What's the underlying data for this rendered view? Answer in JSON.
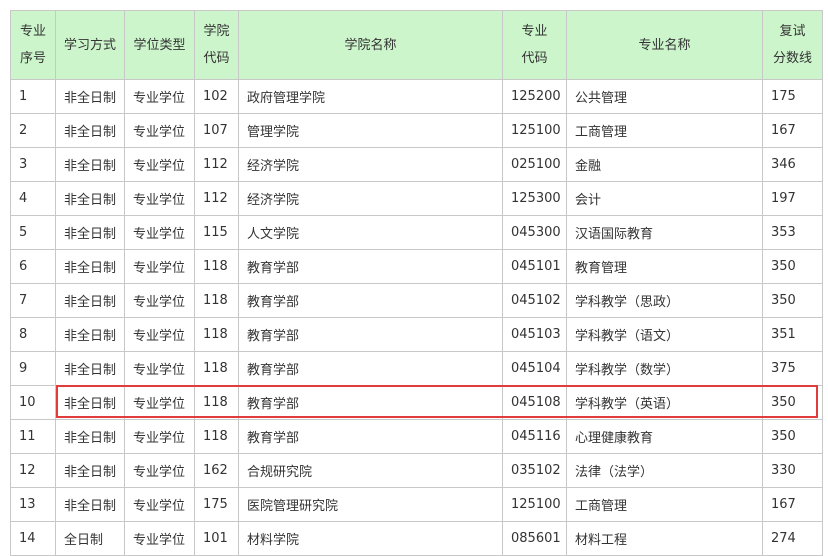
{
  "headers": {
    "seq": [
      "专业",
      "序号"
    ],
    "mode": "学习方式",
    "degree": "学位类型",
    "college_code": [
      "学院",
      "代码"
    ],
    "college_name": "学院名称",
    "major_code": [
      "专业",
      "代码"
    ],
    "major_name": "专业名称",
    "score": [
      "复试",
      "分数线"
    ]
  },
  "rows": [
    [
      "1",
      "非全日制",
      "专业学位",
      "102",
      "政府管理学院",
      "125200",
      "公共管理",
      "175"
    ],
    [
      "2",
      "非全日制",
      "专业学位",
      "107",
      "管理学院",
      "125100",
      "工商管理",
      "167"
    ],
    [
      "3",
      "非全日制",
      "专业学位",
      "112",
      "经济学院",
      "025100",
      "金融",
      "346"
    ],
    [
      "4",
      "非全日制",
      "专业学位",
      "112",
      "经济学院",
      "125300",
      "会计",
      "197"
    ],
    [
      "5",
      "非全日制",
      "专业学位",
      "115",
      "人文学院",
      "045300",
      "汉语国际教育",
      "353"
    ],
    [
      "6",
      "非全日制",
      "专业学位",
      "118",
      "教育学部",
      "045101",
      "教育管理",
      "350"
    ],
    [
      "7",
      "非全日制",
      "专业学位",
      "118",
      "教育学部",
      "045102",
      "学科教学（思政）",
      "350"
    ],
    [
      "8",
      "非全日制",
      "专业学位",
      "118",
      "教育学部",
      "045103",
      "学科教学（语文）",
      "351"
    ],
    [
      "9",
      "非全日制",
      "专业学位",
      "118",
      "教育学部",
      "045104",
      "学科教学（数学）",
      "375"
    ],
    [
      "10",
      "非全日制",
      "专业学位",
      "118",
      "教育学部",
      "045108",
      "学科教学（英语）",
      "350"
    ],
    [
      "11",
      "非全日制",
      "专业学位",
      "118",
      "教育学部",
      "045116",
      "心理健康教育",
      "350"
    ],
    [
      "12",
      "非全日制",
      "专业学位",
      "162",
      "合规研究院",
      "035102",
      "法律（法学）",
      "330"
    ],
    [
      "13",
      "非全日制",
      "专业学位",
      "175",
      "医院管理研究院",
      "125100",
      "工商管理",
      "167"
    ],
    [
      "14",
      "全日制",
      "专业学位",
      "101",
      "材料学院",
      "085601",
      "材料工程",
      "274"
    ]
  ],
  "highlight": {
    "row": "10",
    "color": "#e03c3c"
  },
  "colors": {
    "header_bg": "#ccf5cc",
    "border": "#c8c8c8",
    "text": "#333333"
  }
}
